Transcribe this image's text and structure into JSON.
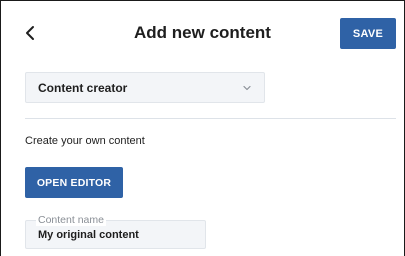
{
  "header": {
    "title": "Add new content",
    "back_icon": "chevron-left-icon",
    "save_label": "SAVE"
  },
  "select": {
    "value": "Content creator",
    "icon": "chevron-down-icon"
  },
  "description": "Create your own content",
  "open_editor_label": "OPEN EDITOR",
  "content_name": {
    "label": "Content name",
    "value": "My original content"
  },
  "colors": {
    "primary": "#2f62a6",
    "field_bg": "#f3f5f8",
    "divider": "#dde2e8"
  }
}
